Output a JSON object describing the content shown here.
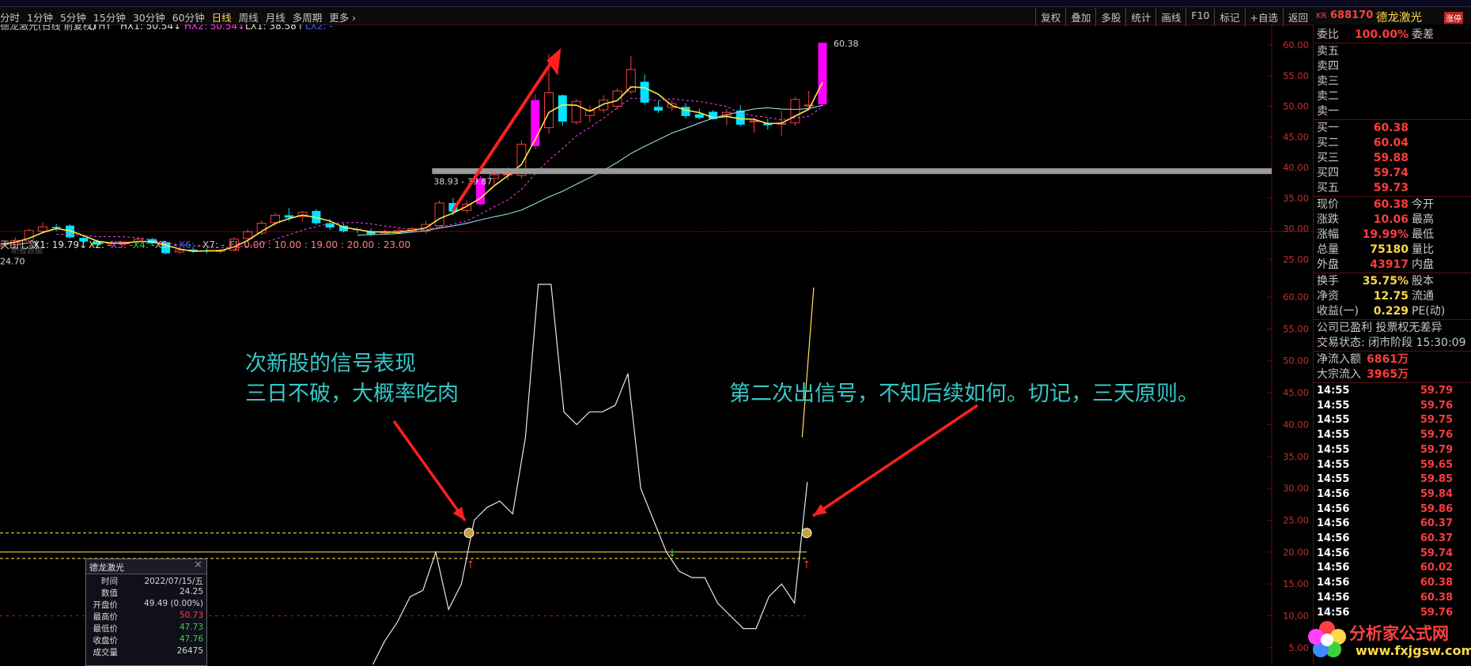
{
  "toolbar": {
    "periods": [
      {
        "label": "分时",
        "active": false
      },
      {
        "label": "1分钟",
        "active": false
      },
      {
        "label": "5分钟",
        "active": false
      },
      {
        "label": "15分钟",
        "active": false
      },
      {
        "label": "30分钟",
        "active": false
      },
      {
        "label": "60分钟",
        "active": false
      },
      {
        "label": "日线",
        "active": true
      },
      {
        "label": "周线",
        "active": false
      },
      {
        "label": "月线",
        "active": false
      },
      {
        "label": "多周期",
        "active": false
      },
      {
        "label": "更多 ›",
        "active": false
      }
    ],
    "right_buttons": [
      "复权",
      "叠加",
      "多股",
      "统计",
      "画线",
      "F10",
      "标记",
      "+自选",
      "返回"
    ]
  },
  "stock": {
    "market": "KR",
    "code": "688170",
    "name": "德龙激光",
    "tag": "涨停"
  },
  "main_chart": {
    "header_title": "德龙激光(日线 前复权)",
    "header_ind": "LTHY",
    "hx1": "HX1: 50.54↓",
    "hx2": "HX2: 50.54↓",
    "lx1": "LX1: 38.58↑",
    "lx2": "LX2: -",
    "y_ticks": [
      "60.00",
      "55.00",
      "50.00",
      "45.00",
      "40.00",
      "35.00",
      "30.00",
      "25.00"
    ],
    "max_label": "60.38",
    "level_label": "38.93 - 39.87",
    "low_label": "24.70",
    "low_note": "新股数据",
    "candles": [
      {
        "o": 27.2,
        "h": 27.8,
        "l": 26.6,
        "c": 27.5
      },
      {
        "o": 27.4,
        "h": 28.6,
        "l": 27.0,
        "c": 28.1
      },
      {
        "o": 28.0,
        "h": 30.0,
        "l": 27.8,
        "c": 29.7
      },
      {
        "o": 29.6,
        "h": 31.0,
        "l": 29.2,
        "c": 30.3
      },
      {
        "o": 30.3,
        "h": 30.8,
        "l": 29.6,
        "c": 30.1
      },
      {
        "o": 30.5,
        "h": 30.7,
        "l": 28.4,
        "c": 28.6
      },
      {
        "o": 28.5,
        "h": 28.9,
        "l": 27.6,
        "c": 27.9
      },
      {
        "o": 27.9,
        "h": 28.2,
        "l": 27.0,
        "c": 27.4
      },
      {
        "o": 27.6,
        "h": 28.0,
        "l": 27.1,
        "c": 27.7
      },
      {
        "o": 27.5,
        "h": 28.1,
        "l": 27.2,
        "c": 27.8
      },
      {
        "o": 27.9,
        "h": 28.6,
        "l": 27.5,
        "c": 28.3
      },
      {
        "o": 28.3,
        "h": 28.5,
        "l": 27.2,
        "c": 27.6
      },
      {
        "o": 27.8,
        "h": 27.9,
        "l": 25.8,
        "c": 26.0
      },
      {
        "o": 26.2,
        "h": 26.9,
        "l": 25.8,
        "c": 26.5
      },
      {
        "o": 26.6,
        "h": 26.9,
        "l": 26.1,
        "c": 26.4
      },
      {
        "o": 26.4,
        "h": 26.8,
        "l": 26.0,
        "c": 26.3
      },
      {
        "o": 26.3,
        "h": 26.7,
        "l": 26.0,
        "c": 26.5
      },
      {
        "o": 26.5,
        "h": 28.6,
        "l": 26.3,
        "c": 28.3
      },
      {
        "o": 28.4,
        "h": 29.9,
        "l": 28.0,
        "c": 29.5
      },
      {
        "o": 29.3,
        "h": 31.3,
        "l": 29.0,
        "c": 30.9
      },
      {
        "o": 31.0,
        "h": 32.6,
        "l": 30.5,
        "c": 32.2
      },
      {
        "o": 32.2,
        "h": 33.4,
        "l": 31.3,
        "c": 31.8
      },
      {
        "o": 32.0,
        "h": 32.9,
        "l": 31.2,
        "c": 32.7
      },
      {
        "o": 32.9,
        "h": 33.2,
        "l": 30.6,
        "c": 30.9
      },
      {
        "o": 30.9,
        "h": 31.6,
        "l": 29.8,
        "c": 30.2
      },
      {
        "o": 30.5,
        "h": 30.8,
        "l": 29.4,
        "c": 29.6
      },
      {
        "o": 29.9,
        "h": 30.2,
        "l": 29.3,
        "c": 29.8
      },
      {
        "o": 29.6,
        "h": 30.0,
        "l": 28.8,
        "c": 29.1
      },
      {
        "o": 29.3,
        "h": 29.8,
        "l": 29.0,
        "c": 29.5
      },
      {
        "o": 29.5,
        "h": 30.0,
        "l": 29.2,
        "c": 29.7
      },
      {
        "o": 29.7,
        "h": 30.3,
        "l": 29.4,
        "c": 30.0
      },
      {
        "o": 29.6,
        "h": 31.3,
        "l": 29.2,
        "c": 30.7
      },
      {
        "o": 30.5,
        "h": 34.6,
        "l": 30.0,
        "c": 34.2
      },
      {
        "o": 34.2,
        "h": 35.0,
        "l": 32.2,
        "c": 32.8
      },
      {
        "o": 33.0,
        "h": 34.6,
        "l": 32.6,
        "c": 34.0
      },
      {
        "o": 34.0,
        "h": 38.6,
        "l": 33.9,
        "c": 38.2
      },
      {
        "o": 38.2,
        "h": 39.5,
        "l": 37.2,
        "c": 38.8
      },
      {
        "o": 38.8,
        "h": 40.0,
        "l": 37.9,
        "c": 38.9
      },
      {
        "o": 38.7,
        "h": 44.5,
        "l": 38.2,
        "c": 43.8
      },
      {
        "o": 43.5,
        "h": 52.0,
        "l": 43.0,
        "c": 51.0
      },
      {
        "o": 46.5,
        "h": 58.6,
        "l": 45.5,
        "c": 52.2
      },
      {
        "o": 51.8,
        "h": 51.9,
        "l": 46.8,
        "c": 47.5
      },
      {
        "o": 47.4,
        "h": 51.2,
        "l": 47.0,
        "c": 50.8
      },
      {
        "o": 48.5,
        "h": 50.1,
        "l": 47.4,
        "c": 49.3
      },
      {
        "o": 49.4,
        "h": 51.8,
        "l": 48.9,
        "c": 51.0
      },
      {
        "o": 50.0,
        "h": 52.9,
        "l": 49.4,
        "c": 52.5
      },
      {
        "o": 52.4,
        "h": 58.2,
        "l": 52.0,
        "c": 56.0
      },
      {
        "o": 54.0,
        "h": 55.2,
        "l": 50.2,
        "c": 50.6
      },
      {
        "o": 49.9,
        "h": 50.8,
        "l": 48.9,
        "c": 49.3
      },
      {
        "o": 49.8,
        "h": 51.0,
        "l": 49.2,
        "c": 50.4
      },
      {
        "o": 49.9,
        "h": 50.5,
        "l": 48.0,
        "c": 48.4
      },
      {
        "o": 48.7,
        "h": 49.6,
        "l": 47.8,
        "c": 48.1
      },
      {
        "o": 49.1,
        "h": 49.4,
        "l": 47.8,
        "c": 47.9
      },
      {
        "o": 48.5,
        "h": 49.6,
        "l": 46.9,
        "c": 49.0
      },
      {
        "o": 49.3,
        "h": 50.2,
        "l": 46.7,
        "c": 47.0
      },
      {
        "o": 47.6,
        "h": 48.2,
        "l": 45.7,
        "c": 47.6
      },
      {
        "o": 47.3,
        "h": 48.0,
        "l": 46.2,
        "c": 46.9
      },
      {
        "o": 47.1,
        "h": 49.2,
        "l": 45.2,
        "c": 47.2
      },
      {
        "o": 47.3,
        "h": 51.5,
        "l": 46.8,
        "c": 51.1
      },
      {
        "o": 50.2,
        "h": 52.5,
        "l": 49.7,
        "c": 50.2
      },
      {
        "o": 50.3,
        "h": 60.38,
        "l": 50.0,
        "c": 60.38
      }
    ]
  },
  "sub_chart": {
    "header_title": "天山七剑",
    "x1": "X1: 19.79↓",
    "x2": "X2: -",
    "x3": "X3: -",
    "x4": "X4: -",
    "x5": "X5: -",
    "x6": "X6: -",
    "x7": "X7: -",
    "fj": "FJ: 0.00 : 10.00 : 19.00 : 20.00 : 23.00",
    "y_ticks": [
      "60.00",
      "55.00",
      "50.00",
      "45.00",
      "40.00",
      "35.00",
      "30.00",
      "25.00",
      "20.00",
      "15.00",
      "10.00",
      "5.00"
    ],
    "annotation1_line1": "次新股的信号表现",
    "annotation1_line2": "三日不破，大概率吃肉",
    "annotation2": "第二次出信号，不知后续如何。切记，三天原则。",
    "line_values": [
      2,
      6,
      9,
      13,
      14,
      20,
      11,
      15,
      25,
      27,
      28,
      26,
      38,
      62,
      62,
      42,
      40,
      42,
      42,
      43,
      48,
      30,
      25,
      20,
      17,
      16,
      16,
      12,
      10,
      8,
      8,
      13,
      15,
      12,
      31
    ],
    "tail_values": [
      38,
      61.5
    ]
  },
  "info_box": {
    "title": "德龙激光",
    "rows": [
      {
        "k": "时间",
        "v": "2022/07/15/五",
        "color": "#d8d8d8"
      },
      {
        "k": "数值",
        "v": "24.25",
        "color": "#d8d8d8"
      },
      {
        "k": "开盘价",
        "v": "49.49 (0.00%)",
        "color": "#d8d8d8"
      },
      {
        "k": "最高价",
        "v": "50.73",
        "color": "#ff3c3c"
      },
      {
        "k": "最低价",
        "v": "47.73",
        "color": "#3cd23c"
      },
      {
        "k": "收盘价",
        "v": "47.76",
        "color": "#3cd23c"
      },
      {
        "k": "成交量",
        "v": "26475",
        "color": "#d8d8d8"
      }
    ]
  },
  "quote": {
    "weibi": {
      "k": "委比",
      "v": "100.00%",
      "k2": "委差"
    },
    "sells": [
      "卖五",
      "卖四",
      "卖三",
      "卖二",
      "卖一"
    ],
    "buys": [
      {
        "k": "买一",
        "v": "60.38"
      },
      {
        "k": "买二",
        "v": "60.04"
      },
      {
        "k": "买三",
        "v": "59.88"
      },
      {
        "k": "买四",
        "v": "59.74"
      },
      {
        "k": "买五",
        "v": "59.73"
      }
    ],
    "stats": [
      {
        "k": "现价",
        "v": "60.38",
        "vc": "red",
        "k2": "今开"
      },
      {
        "k": "涨跌",
        "v": "10.06",
        "vc": "red",
        "k2": "最高"
      },
      {
        "k": "涨幅",
        "v": "19.99%",
        "vc": "red",
        "k2": "最低"
      },
      {
        "k": "总量",
        "v": "75180",
        "vc": "yel",
        "k2": "量比"
      },
      {
        "k": "外盘",
        "v": "43917",
        "vc": "red",
        "k2": "内盘"
      }
    ],
    "fin": [
      {
        "k": "换手",
        "v": "35.75%",
        "k2": "股本"
      },
      {
        "k": "净资",
        "v": "12.75",
        "k2": "流通"
      },
      {
        "k": "收益(一)",
        "v": "0.229",
        "k2": "PE(动)"
      }
    ],
    "company_line": "公司已盈利 投票权无差异",
    "trade_status": "交易状态: 闭市阶段 15:30:09",
    "net_inflow": {
      "k": "净流入额",
      "v": "6861万"
    },
    "block_inflow": {
      "k": "大宗流入",
      "v": "3965万"
    },
    "ticks": [
      {
        "t": "14:55",
        "p": "59.79"
      },
      {
        "t": "14:55",
        "p": "59.76"
      },
      {
        "t": "14:55",
        "p": "59.75"
      },
      {
        "t": "14:55",
        "p": "59.76"
      },
      {
        "t": "14:55",
        "p": "59.79"
      },
      {
        "t": "14:55",
        "p": "59.65"
      },
      {
        "t": "14:55",
        "p": "59.85"
      },
      {
        "t": "14:56",
        "p": "59.84"
      },
      {
        "t": "14:56",
        "p": "59.86"
      },
      {
        "t": "14:56",
        "p": "60.37"
      },
      {
        "t": "14:56",
        "p": "60.37"
      },
      {
        "t": "14:56",
        "p": "59.74"
      },
      {
        "t": "14:56",
        "p": "60.02"
      },
      {
        "t": "14:56",
        "p": "60.38"
      },
      {
        "t": "14:56",
        "p": "60.38"
      },
      {
        "t": "14:56",
        "p": "59.76"
      }
    ]
  },
  "watermark": {
    "line1": "分析家公式网",
    "line2": "www.fxjgsw.com"
  },
  "colors": {
    "up": "#ff3c3c",
    "down_body": "#00e5ff",
    "limit_up": "#ff00ff",
    "ma_yellow": "#ffe64a",
    "ma_cyan": "#9ad7e6",
    "grid": "#5a1010"
  }
}
